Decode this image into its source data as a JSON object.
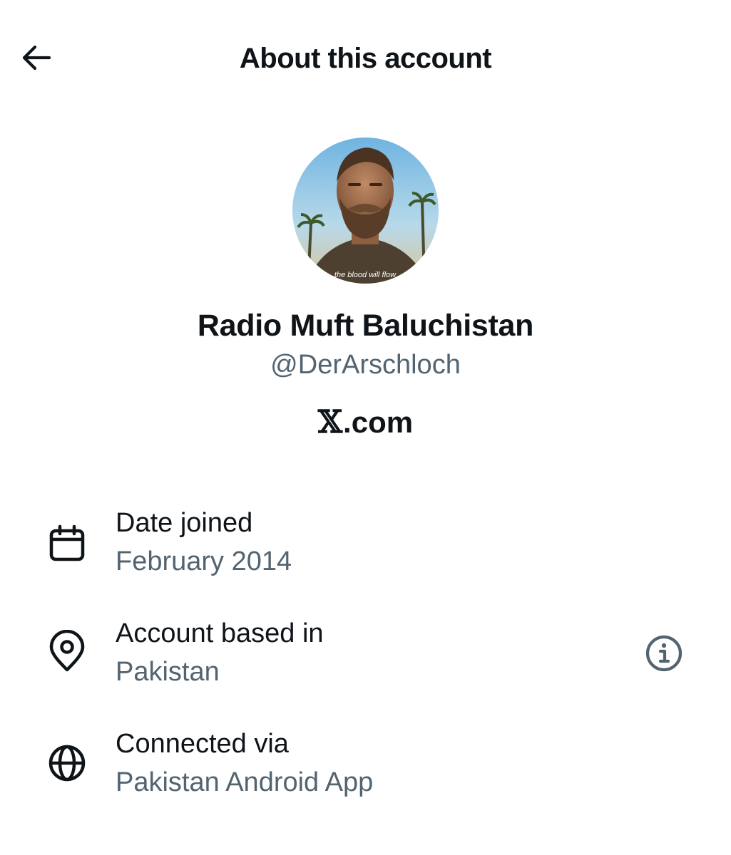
{
  "header": {
    "back_icon": "arrow-left-icon",
    "title": "About this account"
  },
  "profile": {
    "avatar_caption": "the blood will flow",
    "display_name": "Radio Muft Baluchistan",
    "handle": "@DerArschloch",
    "brand_x": "𝕏",
    "brand_suffix": ".com"
  },
  "details": [
    {
      "icon": "calendar-icon",
      "label": "Date joined",
      "value": "February 2014"
    },
    {
      "icon": "location-pin-icon",
      "label": "Account based in",
      "value": "Pakistan",
      "action_icon": "info-icon"
    },
    {
      "icon": "globe-icon",
      "label": "Connected via",
      "value": "Pakistan Android App"
    }
  ],
  "colors": {
    "text_primary": "#0f1419",
    "text_secondary": "#536471",
    "background": "#ffffff"
  }
}
